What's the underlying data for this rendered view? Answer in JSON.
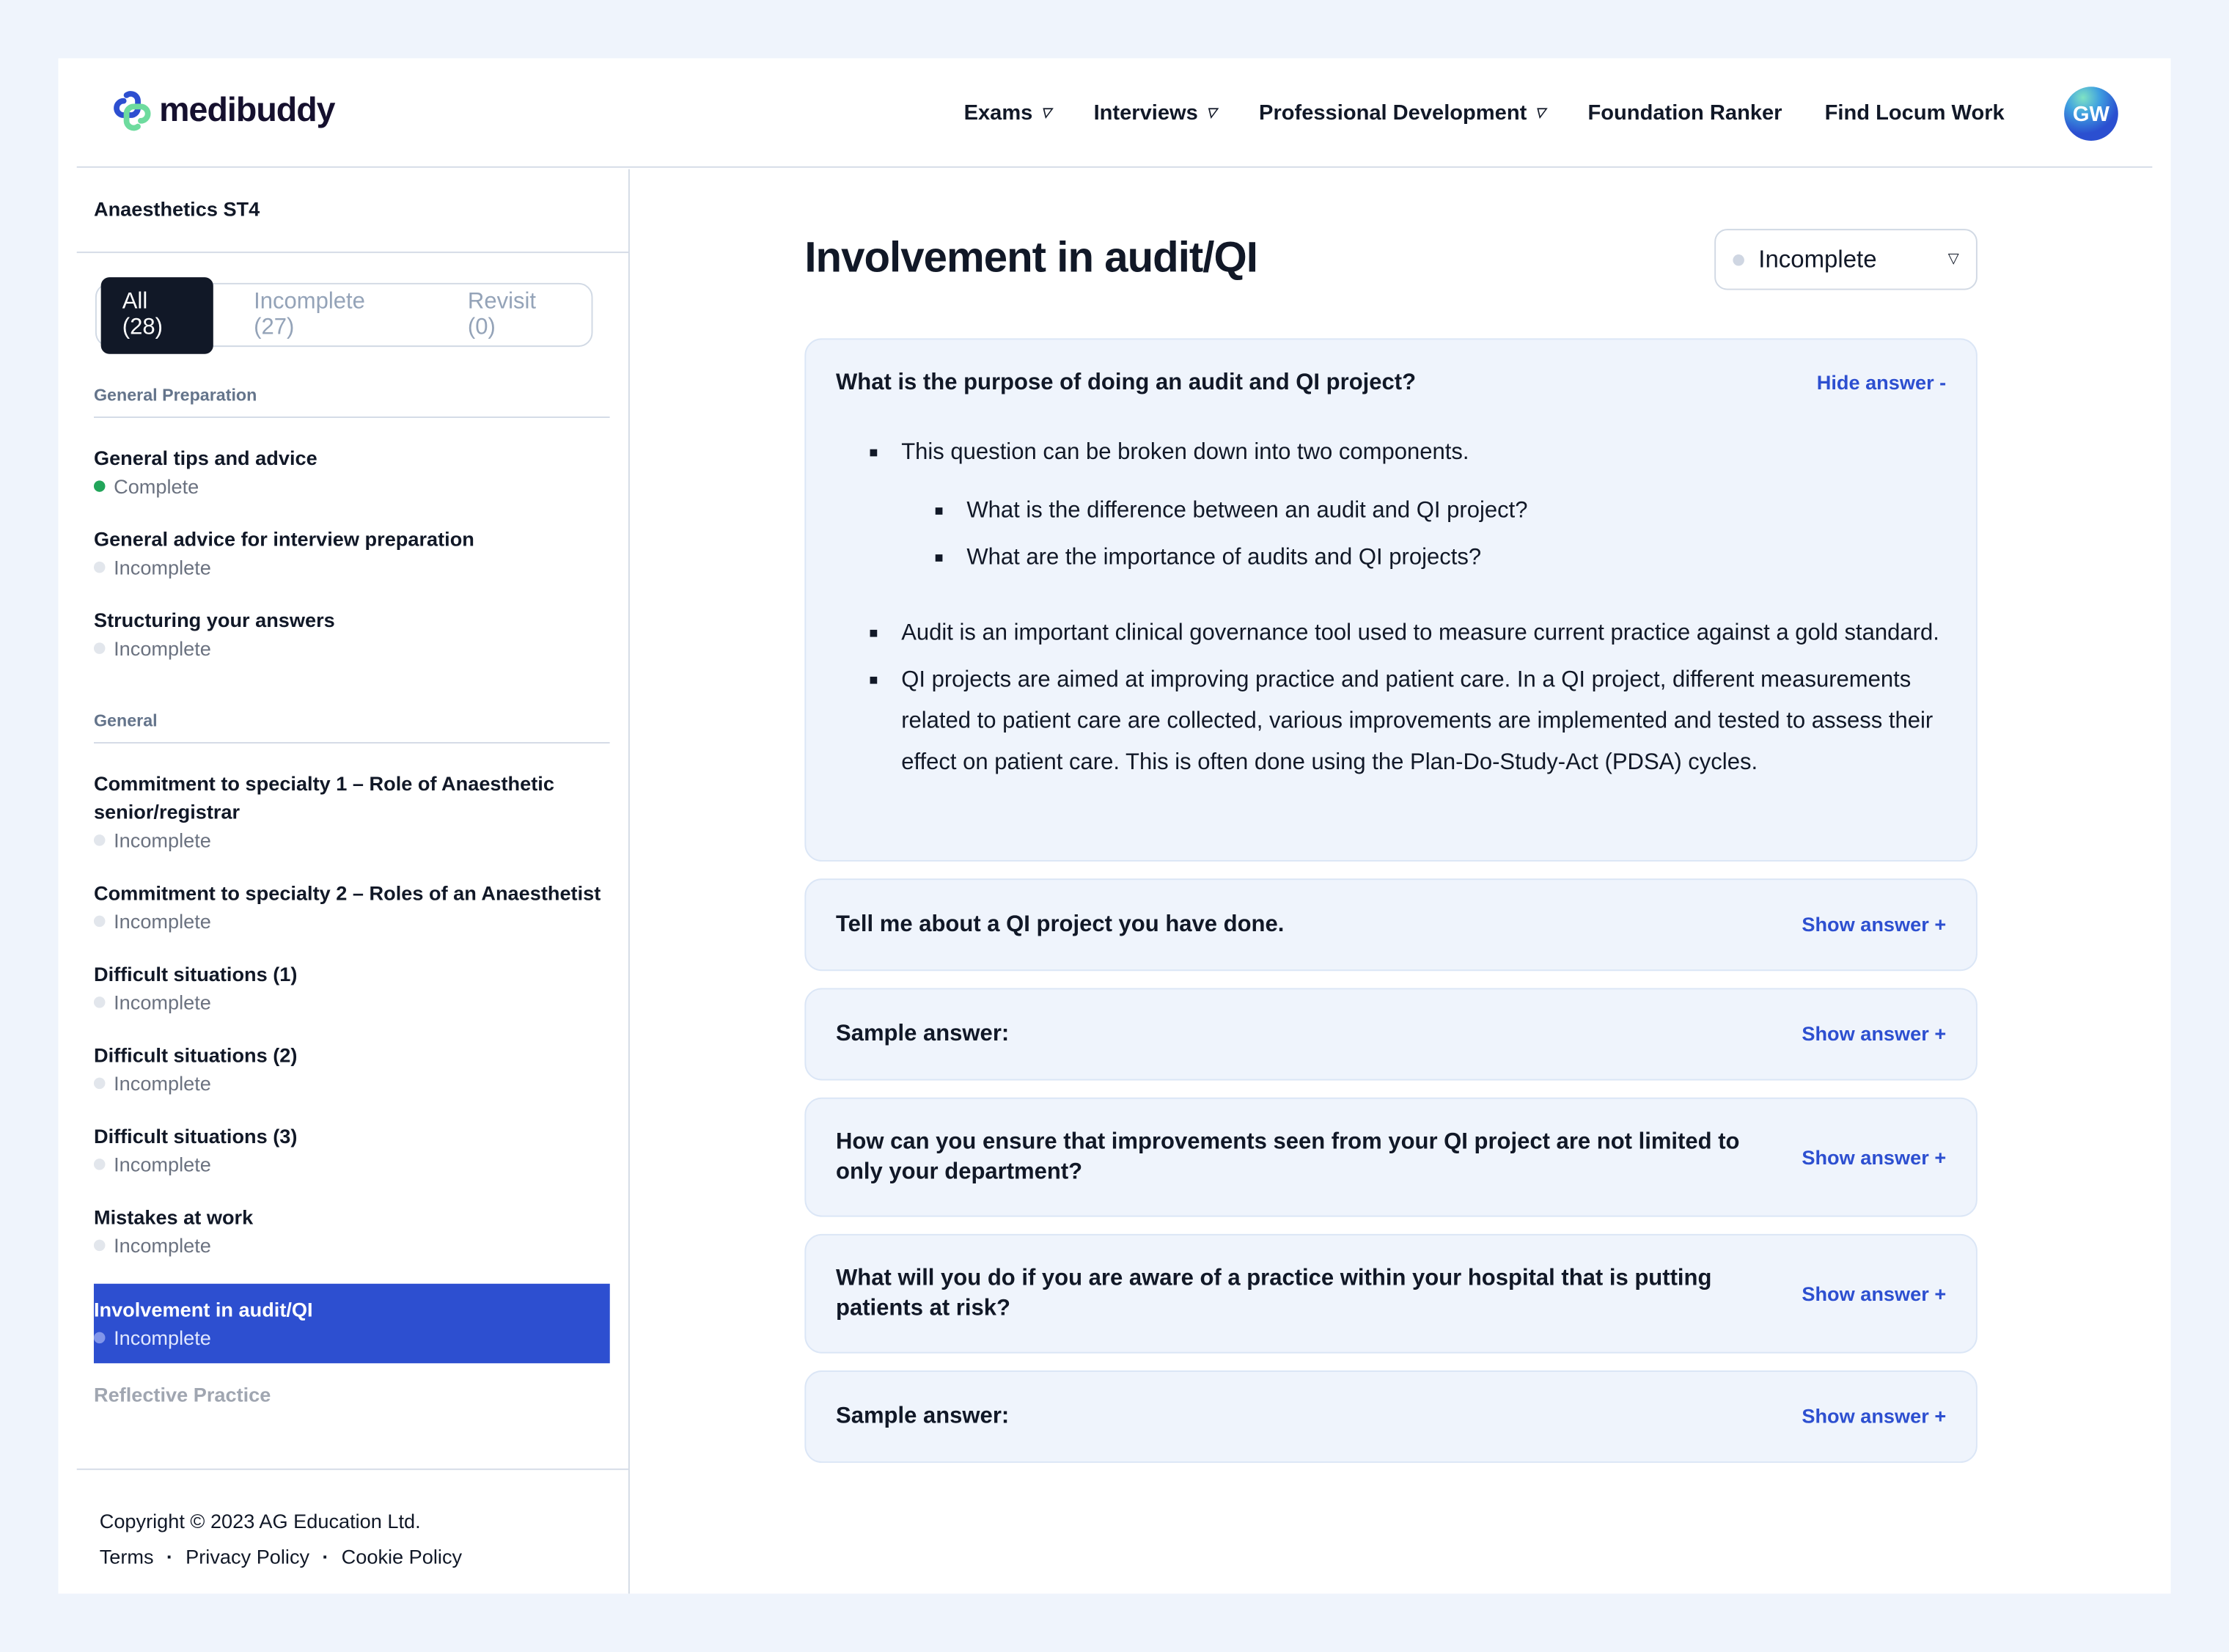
{
  "brand": {
    "name": "medibuddy",
    "colors": {
      "blue": "#2d4fd0",
      "green": "#6ddb9e",
      "dark": "#15102e"
    }
  },
  "nav": {
    "items": [
      {
        "label": "Exams",
        "caret": true
      },
      {
        "label": "Interviews",
        "caret": true
      },
      {
        "label": "Professional Development",
        "caret": true
      },
      {
        "label": "Foundation Ranker",
        "caret": false
      },
      {
        "label": "Find Locum Work",
        "caret": false
      }
    ],
    "avatar": "GW"
  },
  "sidebar": {
    "title": "Anaesthetics ST4",
    "tabs": [
      {
        "label": "All (28)",
        "active": true
      },
      {
        "label": "Incomplete (27)"
      },
      {
        "label": "Revisit (0)"
      }
    ],
    "groups": [
      {
        "label": "General Preparation",
        "items": [
          {
            "title": "General tips and advice",
            "status": "Complete"
          },
          {
            "title": "General advice for interview preparation",
            "status": "Incomplete"
          },
          {
            "title": "Structuring your answers",
            "status": "Incomplete"
          }
        ]
      },
      {
        "label": "General",
        "items": [
          {
            "title": "Commitment to specialty 1 – Role of Anaesthetic senior/registrar",
            "status": "Incomplete"
          },
          {
            "title": "Commitment to specialty 2 – Roles of an Anaesthetist",
            "status": "Incomplete"
          },
          {
            "title": "Difficult situations (1)",
            "status": "Incomplete"
          },
          {
            "title": "Difficult situations (2)",
            "status": "Incomplete"
          },
          {
            "title": "Difficult situations (3)",
            "status": "Incomplete"
          },
          {
            "title": "Mistakes at work",
            "status": "Incomplete"
          },
          {
            "title": "Involvement in audit/QI",
            "status": "Incomplete",
            "selected": true
          }
        ]
      }
    ],
    "next_group": "Reflective Practice",
    "footer": {
      "copyright": "Copyright © 2023 AG Education Ltd.",
      "links": [
        "Terms",
        "Privacy Policy",
        "Cookie Policy"
      ],
      "separator": "·"
    }
  },
  "main": {
    "title": "Involvement in audit/QI",
    "status_select": "Incomplete",
    "questions": [
      {
        "q": "What is the purpose of doing an audit and QI project?",
        "toggle": "Hide answer -",
        "open": true,
        "answer": {
          "b1": "This question can be broken down into two components.",
          "sub": [
            "What is the difference between an audit and QI project?",
            "What are the importance of audits and QI projects?"
          ],
          "b2": "Audit is an important clinical governance tool used to measure current practice against a gold standard.",
          "b3": "QI projects are aimed at improving practice and patient care. In a QI project, different measurements related to patient care are collected, various improvements are implemented and tested to assess their effect on patient care. This is often done using the Plan-Do-Study-Act (PDSA) cycles."
        }
      },
      {
        "q": "Tell me about a QI project you have done.",
        "toggle": "Show answer +"
      },
      {
        "q": "Sample answer:",
        "toggle": "Show answer +"
      },
      {
        "q": "How can you ensure that improvements seen from your QI project are not limited to only your department?",
        "toggle": "Show answer +"
      },
      {
        "q": "What will you do if you are aware of a practice within your hospital that is putting patients at risk?",
        "toggle": "Show answer +"
      },
      {
        "q": "Sample answer:",
        "toggle": "Show answer +"
      }
    ]
  }
}
